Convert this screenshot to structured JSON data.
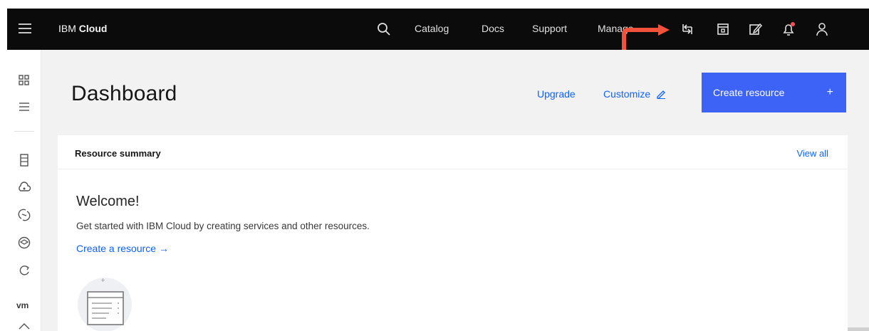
{
  "topbar": {
    "brand_prefix": "IBM",
    "brand_name": "Cloud",
    "nav": {
      "catalog": "Catalog",
      "docs": "Docs",
      "support": "Support",
      "manage": "Manage"
    },
    "icons": [
      "search-icon",
      "switch-account-icon",
      "cost-estimator-icon",
      "edit-icon",
      "notifications-icon",
      "user-icon"
    ],
    "notification_dot_color": "#fa4d56"
  },
  "sidebar": {
    "icons": [
      "dashboard-icon",
      "resource-list-icon",
      "classic-infrastructure-icon",
      "cloud-foundry-icon",
      "interconnect-icon",
      "kubernetes-icon",
      "openshift-icon",
      "vmware-icon"
    ],
    "vm_label": "vm"
  },
  "main": {
    "title": "Dashboard",
    "upgrade": "Upgrade",
    "customize": "Customize",
    "create_resource": "Create resource",
    "create_plus": "+"
  },
  "card": {
    "title": "Resource summary",
    "view_all": "View all",
    "welcome": "Welcome!",
    "subtitle": "Get started with IBM Cloud by creating services and other resources.",
    "create_link": "Create a resource →"
  },
  "colors": {
    "accent": "#0f62fe",
    "button": "#3d63f6",
    "topbar": "#0b0b0b",
    "annotation": "#f2513b"
  }
}
